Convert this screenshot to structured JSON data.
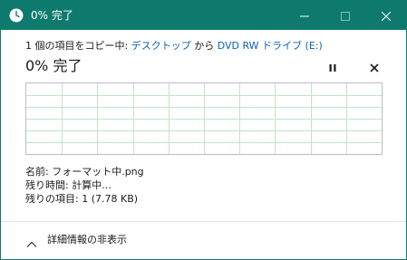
{
  "titlebar": {
    "title": "0% 完了",
    "icons": [
      "clock-icon",
      "minimize-icon",
      "maximize-icon",
      "close-icon"
    ]
  },
  "copy": {
    "prefix": "1 個の項目をコピー中: ",
    "source": "デスクトップ",
    "middle": " から ",
    "destination": "DVD RW ドライブ (E:)"
  },
  "progress": {
    "title": "0% 完了",
    "percent": 0,
    "pause_icon": "pause-icon",
    "cancel_icon": "cancel-icon"
  },
  "details": {
    "name_label": "名前: ",
    "name_value": "フォーマット中.png",
    "time_label": "残り時間: ",
    "time_value": "計算中...",
    "items_label": "残りの項目: ",
    "items_value": "1 (7.78 KB)"
  },
  "footer": {
    "toggle_label": "詳細情報の非表示",
    "toggle_icon": "chevron-up-icon"
  },
  "colors": {
    "titlebar": "#0e7a6e",
    "link": "#0b63b5",
    "grid": "#bfe6c7"
  }
}
